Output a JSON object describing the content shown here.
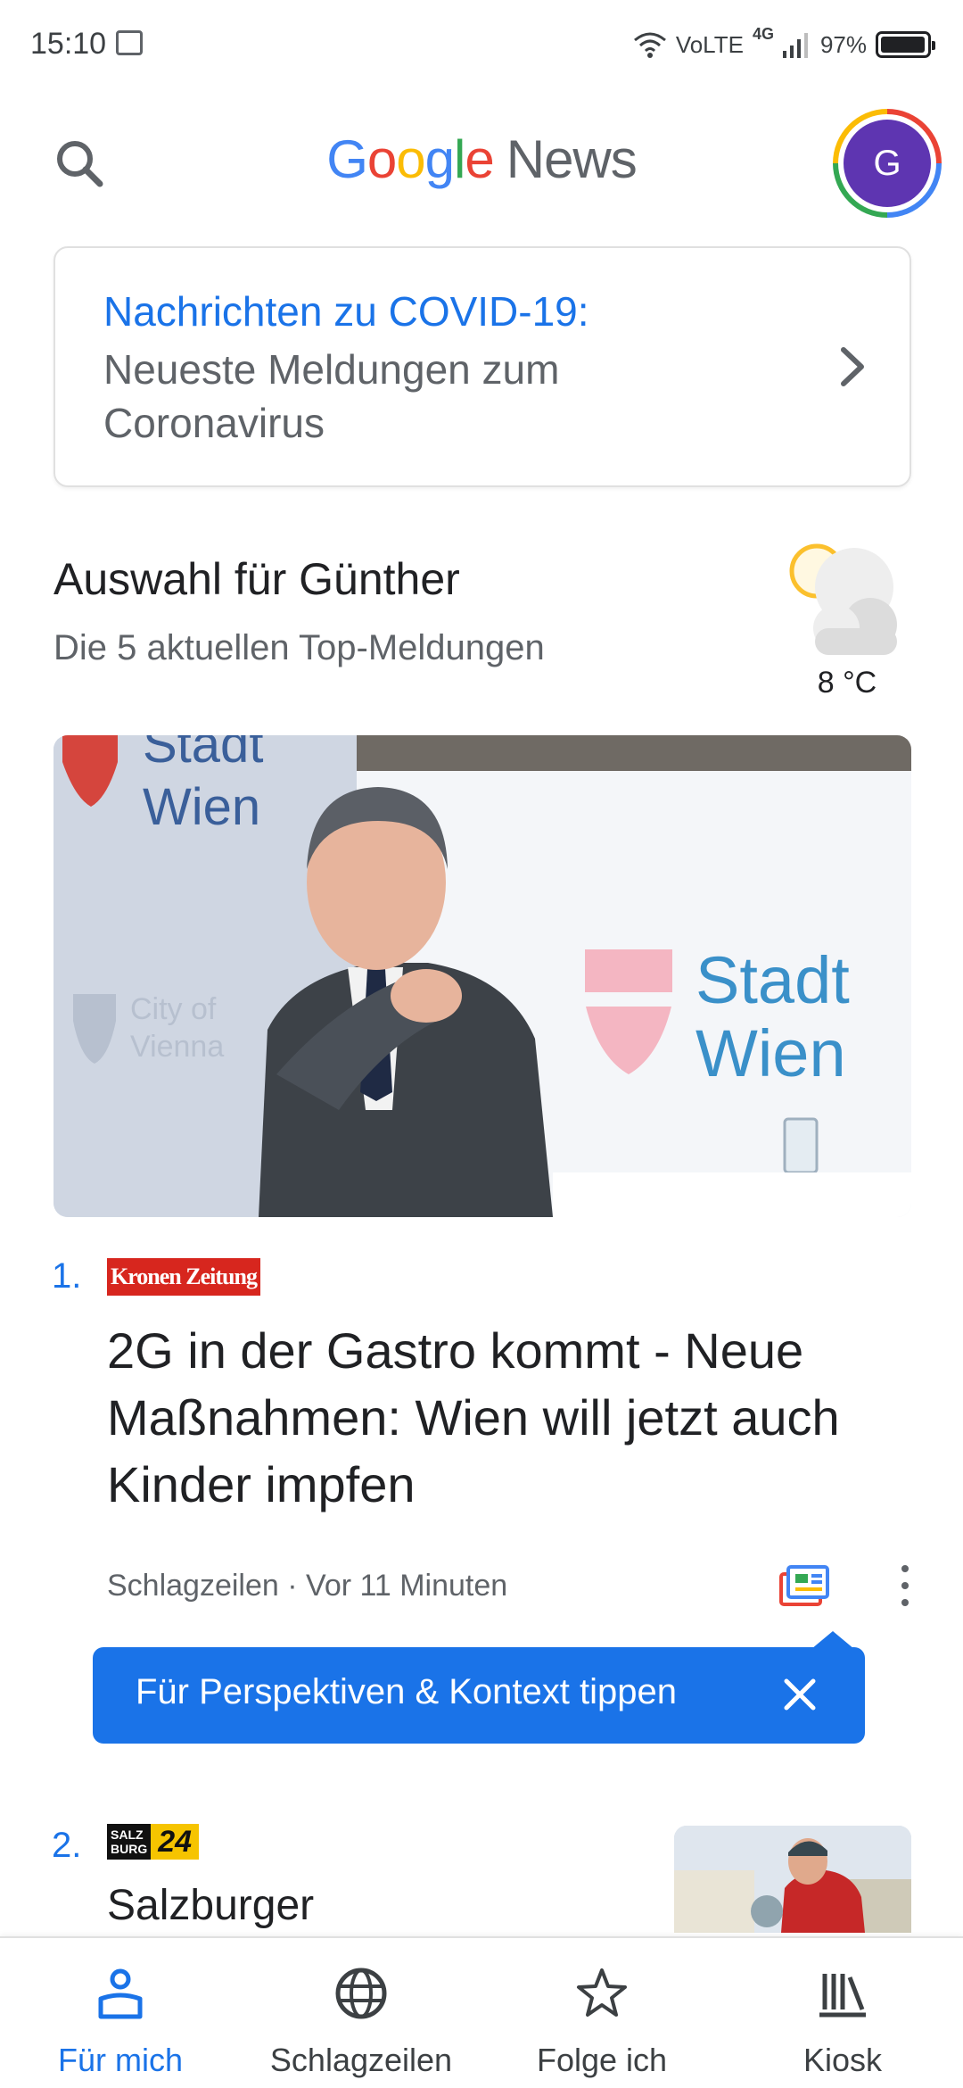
{
  "status_bar": {
    "time": "15:10",
    "network": "VoLTE",
    "cellular": "4G",
    "battery": "97%",
    "battery_level": 0.97
  },
  "header": {
    "brand_letters": [
      "G",
      "o",
      "o",
      "g",
      "l",
      "e"
    ],
    "brand_suffix": "News",
    "avatar_initial": "G"
  },
  "covid_card": {
    "title": "Nachrichten zu COVID-19:",
    "subtitle": "Neueste Meldungen zum Coronavirus"
  },
  "section": {
    "title": "Auswahl für Günther",
    "subtitle": "Die 5 aktuellen Top-Meldungen",
    "weather_temp": "8 °C",
    "weather_icon": "partly-cloudy-icon"
  },
  "hero_image": {
    "sign_text_line1": "Stadt",
    "sign_text_line2": "Wien",
    "banner_text_line1": "City of",
    "banner_text_line2": "Vienna"
  },
  "story1": {
    "number": "1.",
    "publisher": "Kronen Zeitung",
    "headline": "2G in der Gastro kommt - Neue Maßnahmen: Wien will jetzt auch Kinder impfen",
    "source": "Schlagzeilen",
    "separator": " · ",
    "time": "Vor 11 Minuten"
  },
  "tooltip": {
    "text": "Für Perspektiven & Kontext tippen"
  },
  "story2": {
    "number": "2.",
    "publisher_line1": "SALZ",
    "publisher_line2": "BURG",
    "publisher_number": "24",
    "headline": "Salzburger"
  },
  "bottom_nav": {
    "items": [
      {
        "label": "Für mich",
        "icon": "for-you-icon",
        "active": true
      },
      {
        "label": "Schlagzeilen",
        "icon": "globe-icon",
        "active": false
      },
      {
        "label": "Folge ich",
        "icon": "star-icon",
        "active": false
      },
      {
        "label": "Kiosk",
        "icon": "newsstand-icon",
        "active": false
      }
    ]
  },
  "colors": {
    "accent": "#1a73e8",
    "text_primary": "#202124",
    "text_secondary": "#5f6368",
    "avatar_bg": "#5e35b1",
    "kronen_red": "#d7261e",
    "salzburg_yellow": "#f6c400"
  }
}
